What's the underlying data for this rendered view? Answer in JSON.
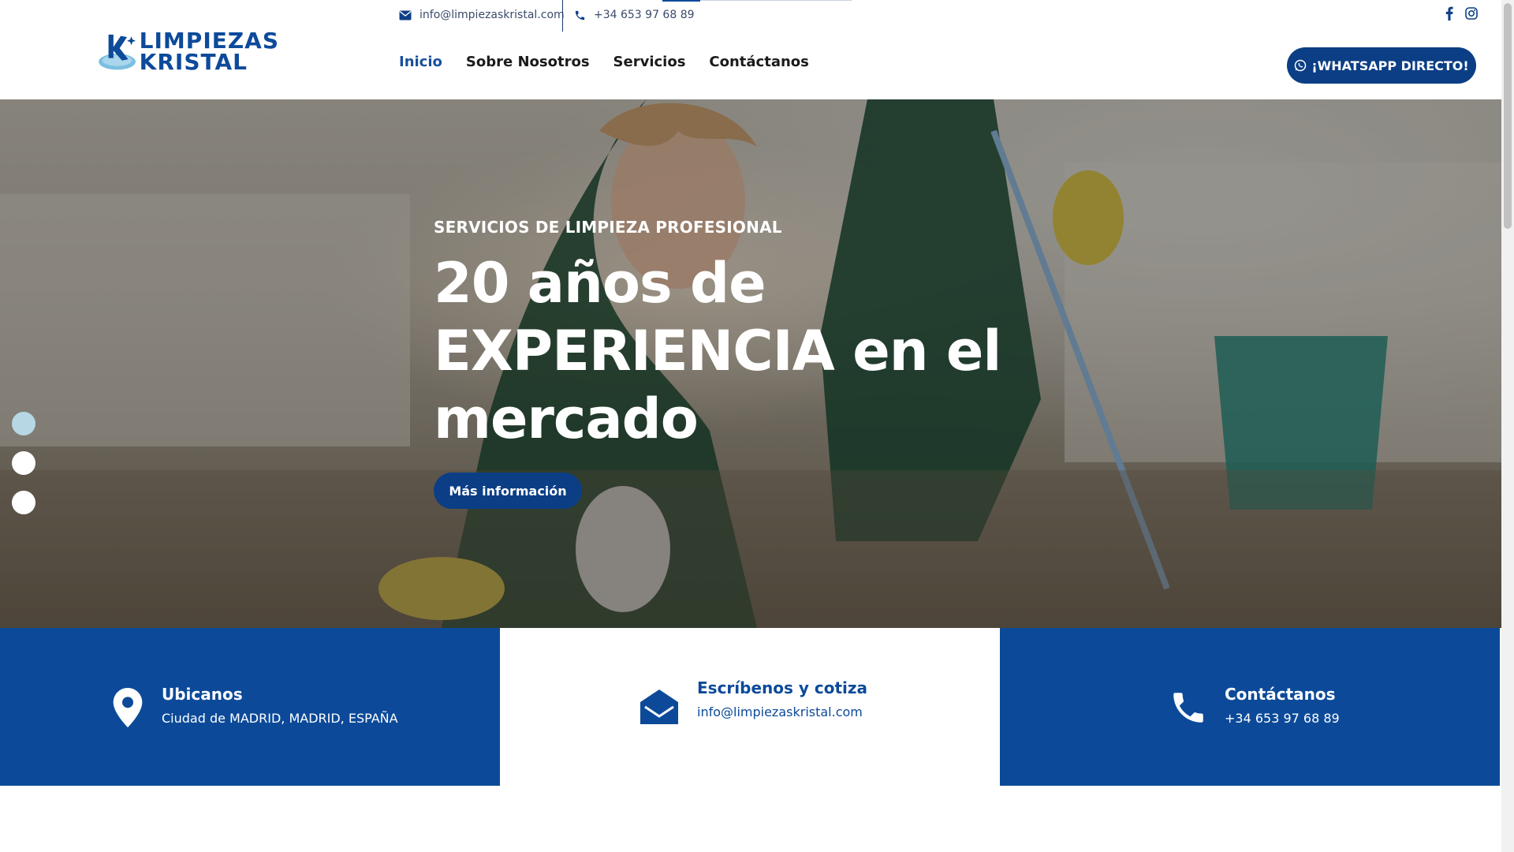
{
  "topbar": {
    "email": "info@limpiezaskristal.com",
    "phone": "+34 653 97 68 89",
    "social": [
      {
        "icon": "facebook-icon"
      },
      {
        "icon": "instagram-icon"
      }
    ]
  },
  "brand": {
    "line1": "LIMPIEZAS",
    "line2": "KRISTAL",
    "color": "#0d4a9a"
  },
  "nav": {
    "items": [
      {
        "label": "Inicio",
        "active": true
      },
      {
        "label": "Sobre Nosotros",
        "active": false
      },
      {
        "label": "Servicios",
        "active": false
      },
      {
        "label": "Contáctanos",
        "active": false
      }
    ],
    "whatsapp_label": "¡WHATSAPP DIRECTO!"
  },
  "hero": {
    "kicker": "SERVICIOS DE LIMPIEZA PROFESIONAL",
    "title_line1": "20 años de",
    "title_line2": "EXPERIENCIA en el",
    "title_line3": "mercado",
    "cta": "Más información",
    "slides": 3,
    "active_slide": 1
  },
  "info": [
    {
      "icon": "map-pin-icon",
      "title": "Ubicanos",
      "text": "Ciudad de MADRID, MADRID, ESPAÑA"
    },
    {
      "icon": "envelope-open-icon",
      "title": "Escríbenos y cotiza",
      "text": "info@limpiezaskristal.com"
    },
    {
      "icon": "phone-icon",
      "title": "Contáctanos",
      "text": "+34 653 97 68 89"
    }
  ],
  "colors": {
    "primary": "#0c4a99",
    "button": "#0b3e85",
    "active_dot": "#b7d7e4"
  }
}
